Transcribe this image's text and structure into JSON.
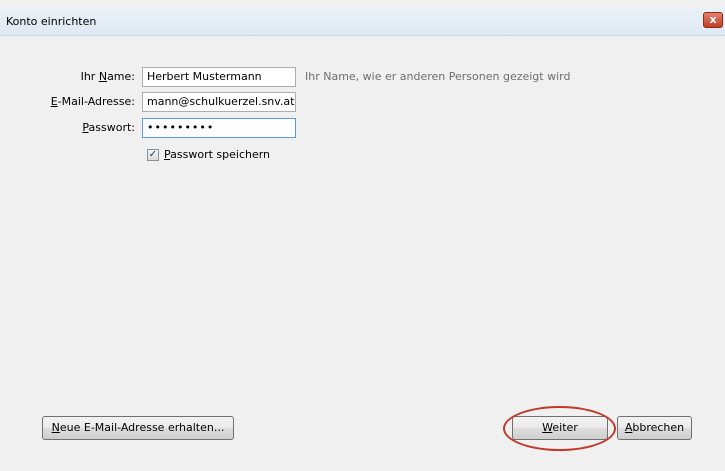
{
  "window": {
    "title": "Konto einrichten",
    "close_label": "x"
  },
  "form": {
    "name_label_prefix": "Ihr ",
    "name_label_access": "N",
    "name_label_rest": "ame:",
    "name_value": "Herbert Mustermann",
    "name_hint": "Ihr Name, wie er anderen Personen gezeigt wird",
    "email_label_access": "E",
    "email_label_rest": "-Mail-Adresse:",
    "email_value": "mann@schulkuerzel.snv.at",
    "password_label_access": "P",
    "password_label_rest": "asswort:",
    "password_value": "•••••••••",
    "remember_checked": true,
    "remember_label_access": "P",
    "remember_label_rest": "asswort speichern"
  },
  "buttons": {
    "new_address_access": "N",
    "new_address_rest": "eue E-Mail-Adresse erhalten...",
    "next_access": "W",
    "next_rest": "eiter",
    "cancel_access": "A",
    "cancel_rest": "bbrechen"
  },
  "colors": {
    "highlight_ring": "#c0392b",
    "focus_border": "#569de5"
  }
}
